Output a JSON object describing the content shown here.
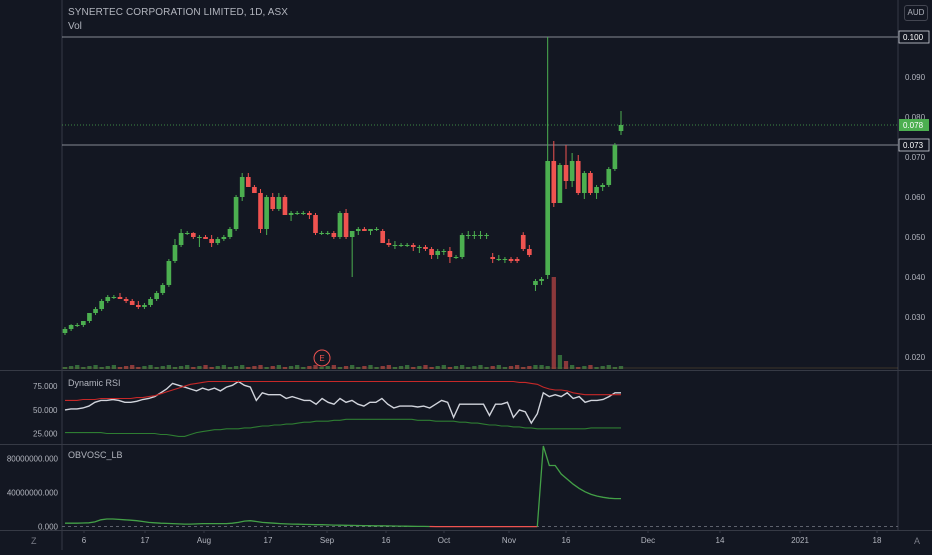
{
  "header": {
    "title": "SYNERTEC CORPORATION LIMITED, 1D, ASX",
    "vol_label": "Vol",
    "currency": "AUD"
  },
  "colors": {
    "background": "#131722",
    "up": "#26a69a",
    "up_candle": "#4caf50",
    "down_candle": "#ef5350",
    "grid_line": "#2a2e39",
    "axis_text": "#b2b5be",
    "rsi_line": "#d1d4dc",
    "rsi_upper": "#c62828",
    "rsi_lower": "#2e7d32",
    "obv_line": "#43a047"
  },
  "panes": {
    "rsi_title": "Dynamic RSI",
    "obv_title": "OBVOSC_LB"
  },
  "bottom_corner": {
    "left": "Z",
    "right": "A"
  },
  "chart_data": [
    {
      "type": "candlestick",
      "title": "SYNERTEC CORPORATION LIMITED, 1D, ASX",
      "xlabel": "",
      "ylabel": "",
      "x_ticks": [
        "6",
        "17",
        "Aug",
        "17",
        "Sep",
        "16",
        "Oct",
        "Nov",
        "16",
        "Dec",
        "14",
        "2021",
        "18"
      ],
      "y_ticks": [
        "0.020",
        "0.030",
        "0.040",
        "0.050",
        "0.060",
        "0.070",
        "0.080",
        "0.090"
      ],
      "ylim": [
        0.017,
        0.1
      ],
      "price_labels": [
        {
          "value": 0.1,
          "text": "0.100",
          "style": "boxed-white"
        },
        {
          "value": 0.078,
          "text": "0.078",
          "style": "green"
        },
        {
          "value": 0.073,
          "text": "0.073",
          "style": "boxed-white"
        }
      ],
      "horizontal_lines": [
        0.1,
        0.073
      ],
      "dotted_line": 0.078,
      "event_marker": "E",
      "candles": [
        [
          0.026,
          0.0275,
          0.0255,
          0.027
        ],
        [
          0.027,
          0.0282,
          0.0265,
          0.028
        ],
        [
          0.028,
          0.0285,
          0.0275,
          0.028
        ],
        [
          0.028,
          0.029,
          0.0275,
          0.029
        ],
        [
          0.029,
          0.031,
          0.0285,
          0.031
        ],
        [
          0.031,
          0.0325,
          0.0305,
          0.032
        ],
        [
          0.032,
          0.0345,
          0.0315,
          0.034
        ],
        [
          0.034,
          0.0355,
          0.0335,
          0.035
        ],
        [
          0.035,
          0.0355,
          0.0345,
          0.035
        ],
        [
          0.035,
          0.036,
          0.0345,
          0.0345
        ],
        [
          0.0345,
          0.035,
          0.0335,
          0.034
        ],
        [
          0.034,
          0.0345,
          0.033,
          0.033
        ],
        [
          0.033,
          0.034,
          0.032,
          0.0325
        ],
        [
          0.0325,
          0.0335,
          0.032,
          0.033
        ],
        [
          0.033,
          0.035,
          0.0325,
          0.0345
        ],
        [
          0.0345,
          0.0365,
          0.034,
          0.036
        ],
        [
          0.036,
          0.0385,
          0.0355,
          0.038
        ],
        [
          0.038,
          0.0445,
          0.0375,
          0.044
        ],
        [
          0.044,
          0.0495,
          0.0435,
          0.048
        ],
        [
          0.048,
          0.052,
          0.0475,
          0.051
        ],
        [
          0.051,
          0.0515,
          0.0505,
          0.051
        ],
        [
          0.051,
          0.0512,
          0.0495,
          0.05
        ],
        [
          0.05,
          0.0505,
          0.0475,
          0.05
        ],
        [
          0.05,
          0.0505,
          0.0495,
          0.0495
        ],
        [
          0.0495,
          0.0505,
          0.0475,
          0.0485
        ],
        [
          0.0485,
          0.05,
          0.048,
          0.0495
        ],
        [
          0.0495,
          0.0505,
          0.049,
          0.05
        ],
        [
          0.05,
          0.0525,
          0.0495,
          0.052
        ],
        [
          0.052,
          0.0605,
          0.0515,
          0.06
        ],
        [
          0.06,
          0.066,
          0.059,
          0.065
        ],
        [
          0.065,
          0.066,
          0.0625,
          0.0625
        ],
        [
          0.0625,
          0.063,
          0.061,
          0.061
        ],
        [
          0.061,
          0.062,
          0.051,
          0.052
        ],
        [
          0.052,
          0.0605,
          0.0505,
          0.06
        ],
        [
          0.06,
          0.061,
          0.0565,
          0.057
        ],
        [
          0.057,
          0.061,
          0.0565,
          0.06
        ],
        [
          0.06,
          0.0605,
          0.0555,
          0.0555
        ],
        [
          0.0555,
          0.0565,
          0.054,
          0.056
        ],
        [
          0.056,
          0.0565,
          0.0555,
          0.056
        ],
        [
          0.056,
          0.0565,
          0.0555,
          0.056
        ],
        [
          0.056,
          0.0565,
          0.0545,
          0.0555
        ],
        [
          0.0555,
          0.056,
          0.0505,
          0.051
        ],
        [
          0.051,
          0.0515,
          0.0505,
          0.051
        ],
        [
          0.051,
          0.0515,
          0.0505,
          0.051
        ],
        [
          0.051,
          0.0515,
          0.0495,
          0.05
        ],
        [
          0.05,
          0.0565,
          0.0495,
          0.056
        ],
        [
          0.056,
          0.057,
          0.0495,
          0.05
        ],
        [
          0.05,
          0.051,
          0.04,
          0.0515
        ],
        [
          0.0515,
          0.0525,
          0.0505,
          0.052
        ],
        [
          0.052,
          0.0525,
          0.0515,
          0.0515
        ],
        [
          0.0515,
          0.052,
          0.0505,
          0.052
        ],
        [
          0.052,
          0.0525,
          0.0515,
          0.052
        ],
        [
          0.0515,
          0.052,
          0.0495,
          0.0485
        ],
        [
          0.0485,
          0.0495,
          0.0475,
          0.048
        ],
        [
          0.048,
          0.049,
          0.047,
          0.048
        ],
        [
          0.048,
          0.0485,
          0.0475,
          0.048
        ],
        [
          0.048,
          0.0485,
          0.0475,
          0.048
        ],
        [
          0.048,
          0.0485,
          0.0465,
          0.0475
        ],
        [
          0.0475,
          0.048,
          0.046,
          0.0475
        ],
        [
          0.0475,
          0.048,
          0.0465,
          0.047
        ],
        [
          0.047,
          0.0475,
          0.0445,
          0.0455
        ],
        [
          0.0455,
          0.047,
          0.0445,
          0.0465
        ],
        [
          0.0465,
          0.047,
          0.0455,
          0.0465
        ],
        [
          0.0465,
          0.0475,
          0.0435,
          0.045
        ],
        [
          0.045,
          0.0455,
          0.0445,
          0.045
        ],
        [
          0.045,
          0.051,
          0.0445,
          0.0505
        ],
        [
          0.0505,
          0.0515,
          0.0495,
          0.0505
        ],
        [
          0.0505,
          0.0515,
          0.0495,
          0.0505
        ],
        [
          0.0505,
          0.0515,
          0.0495,
          0.0505
        ],
        [
          0.0505,
          0.051,
          0.0495,
          0.0505
        ],
        [
          0.045,
          0.046,
          0.0435,
          0.0445
        ],
        [
          0.0445,
          0.0455,
          0.044,
          0.0445
        ],
        [
          0.0445,
          0.045,
          0.0435,
          0.0445
        ],
        [
          0.0445,
          0.045,
          0.0435,
          0.044
        ],
        [
          0.0445,
          0.045,
          0.0435,
          0.044
        ],
        [
          0.0505,
          0.0512,
          0.0465,
          0.047
        ],
        [
          0.047,
          0.048,
          0.045,
          0.0455
        ],
        [
          0.038,
          0.0395,
          0.0365,
          0.039
        ],
        [
          0.039,
          0.04,
          0.038,
          0.0395
        ],
        [
          0.0405,
          0.1,
          0.0395,
          0.069
        ],
        [
          0.069,
          0.074,
          0.0575,
          0.0585
        ],
        [
          0.0585,
          0.0685,
          0.0585,
          0.068
        ],
        [
          0.068,
          0.073,
          0.062,
          0.064
        ],
        [
          0.064,
          0.071,
          0.0625,
          0.069
        ],
        [
          0.069,
          0.0705,
          0.0605,
          0.061
        ],
        [
          0.061,
          0.0665,
          0.0595,
          0.066
        ],
        [
          0.066,
          0.0665,
          0.0605,
          0.061
        ],
        [
          0.061,
          0.063,
          0.0595,
          0.0625
        ],
        [
          0.0625,
          0.0635,
          0.0615,
          0.063
        ],
        [
          0.063,
          0.0675,
          0.0625,
          0.067
        ],
        [
          0.067,
          0.0735,
          0.0665,
          0.073
        ],
        [
          0.0765,
          0.0815,
          0.0755,
          0.078
        ]
      ]
    },
    {
      "type": "line",
      "title": "Dynamic RSI",
      "xlabel": "",
      "ylabel": "",
      "y_ticks": [
        "75.000",
        "50.000",
        "25.000"
      ],
      "ylim": [
        15,
        90
      ],
      "series": [
        {
          "values": [
            50,
            51,
            51,
            52,
            54,
            58,
            60,
            60,
            61,
            60,
            58,
            58,
            59,
            61,
            62,
            64,
            68,
            72,
            78,
            76,
            74,
            72,
            70,
            73,
            71,
            73,
            70,
            74,
            76,
            80,
            76,
            74,
            60,
            68,
            66,
            66,
            66,
            62,
            64,
            62,
            60,
            60,
            56,
            62,
            58,
            56,
            62,
            58,
            60,
            56,
            54,
            58,
            58,
            62,
            56,
            52,
            54,
            54,
            54,
            53,
            54,
            52,
            56,
            60,
            58,
            42,
            56,
            56,
            56,
            56,
            56,
            44,
            56,
            56,
            58,
            42,
            50,
            48,
            36,
            46,
            68,
            64,
            66,
            64,
            68,
            62,
            64,
            58,
            60,
            60,
            61,
            64,
            68,
            68
          ]
        },
        {
          "values": [
            60,
            60,
            60,
            61,
            61,
            61,
            62,
            62,
            62,
            62,
            62,
            62,
            63,
            63,
            64,
            65,
            67,
            69,
            71,
            73,
            75,
            77,
            78,
            79,
            80,
            80,
            80,
            80,
            80,
            80,
            80,
            80,
            80,
            80,
            80,
            80,
            80,
            80,
            80,
            80,
            80,
            80,
            80,
            80,
            80,
            80,
            80,
            80,
            80,
            80,
            80,
            80,
            80,
            80,
            80,
            80,
            80,
            80,
            80,
            80,
            80,
            80,
            80,
            80,
            80,
            80,
            80,
            80,
            80,
            80,
            80,
            80,
            80,
            80,
            80,
            80,
            79,
            79,
            78,
            77,
            74,
            72,
            71,
            71,
            70,
            68,
            67,
            66,
            66,
            66,
            66,
            66,
            66,
            66
          ]
        },
        {
          "values": [
            26,
            26,
            26,
            26,
            26,
            26,
            26,
            25,
            25,
            25,
            25,
            25,
            25,
            25,
            25,
            25,
            24,
            24,
            23,
            22,
            22,
            24,
            26,
            27,
            28,
            29,
            29,
            30,
            30,
            30,
            31,
            31,
            32,
            33,
            33,
            34,
            34,
            35,
            35,
            36,
            37,
            37,
            38,
            38,
            38,
            39,
            39,
            40,
            40,
            40,
            40,
            40,
            40,
            40,
            40,
            40,
            40,
            40,
            40,
            39,
            39,
            39,
            38,
            38,
            38,
            38,
            37,
            37,
            36,
            36,
            35,
            34,
            34,
            33,
            33,
            32,
            32,
            31,
            31,
            30,
            30,
            30,
            30,
            30,
            30,
            30,
            30,
            30,
            31,
            31,
            31,
            31,
            31,
            31
          ]
        }
      ]
    },
    {
      "type": "line",
      "title": "OBVOSC_LB",
      "xlabel": "",
      "ylabel": "",
      "y_ticks": [
        "80000000.000",
        "40000000.000",
        "0.000"
      ],
      "ylim": [
        -4000000,
        95000000
      ],
      "series": [
        {
          "values": [
            4000000,
            4000000,
            4000000,
            4200000,
            4500000,
            5500000,
            8000000,
            9000000,
            9000000,
            8500000,
            8000000,
            7500000,
            7000000,
            6000000,
            5000000,
            4500000,
            4000000,
            3800000,
            3500000,
            3200000,
            3000000,
            3000000,
            3200000,
            3500000,
            3500000,
            3500000,
            3600000,
            3500000,
            4000000,
            5000000,
            6500000,
            7000000,
            6000000,
            5000000,
            4500000,
            4000000,
            3500000,
            3200000,
            3000000,
            2800000,
            2600000,
            2500000,
            2300000,
            2200000,
            2000000,
            1800000,
            1600000,
            1500000,
            1400000,
            1300000,
            1200000,
            1100000,
            1000000,
            900000,
            800000,
            700000,
            600000,
            500000,
            400000,
            300000,
            200000,
            100000,
            0,
            0,
            0,
            0,
            0,
            0,
            0,
            0,
            0,
            0,
            0,
            0,
            0,
            0,
            0,
            0,
            0,
            0,
            95000000,
            72000000,
            72000000,
            62000000,
            56000000,
            50000000,
            45000000,
            41000000,
            38000000,
            36000000,
            34500000,
            33500000,
            33000000,
            33000000
          ]
        }
      ]
    }
  ]
}
